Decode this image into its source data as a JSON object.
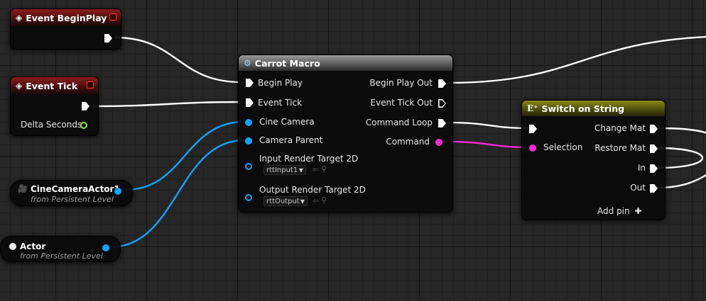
{
  "colors": {
    "exec_wire": "#ffffff",
    "object_wire": "#13a2ff",
    "string_wire": "#ff27d5",
    "float_pin": "#8fe34a",
    "event_header": "#8c1c1c",
    "macro_header": "#9a9a9a",
    "switch_header": "#8a8a18"
  },
  "nodes": {
    "event_begin_play": {
      "title": "Event BeginPlay",
      "icon": "event-diamond-icon"
    },
    "event_tick": {
      "title": "Event Tick",
      "icon": "event-diamond-icon",
      "delta_label": "Delta Seconds"
    },
    "cine_camera_actor": {
      "title": "CineCameraActor1",
      "subtitle": "from Persistent Level",
      "icon": "camera-icon"
    },
    "actor": {
      "title": "Actor",
      "subtitle": "from Persistent Level",
      "icon": "sphere-icon"
    },
    "carrot_macro": {
      "title": "Carrot Macro",
      "icon": "gear-icon",
      "inputs": {
        "begin_play": "Begin Play",
        "event_tick": "Event Tick",
        "cine_camera": "Cine Camera",
        "camera_parent": "Camera Parent",
        "input_rt": "Input Render Target 2D",
        "input_rt_value": "rttInput1",
        "output_rt": "Output Render Target 2D",
        "output_rt_value": "rttOutput"
      },
      "outputs": {
        "begin_play_out": "Begin Play Out",
        "event_tick_out": "Event Tick Out",
        "command_loop": "Command Loop",
        "command": "Command"
      }
    },
    "switch_on_string": {
      "title": "Switch on String",
      "icon": "switch-icon",
      "selection": "Selection",
      "outputs": [
        "Change Mat",
        "Restore Mat",
        "In",
        "Out"
      ],
      "add_pin": "Add pin"
    }
  }
}
